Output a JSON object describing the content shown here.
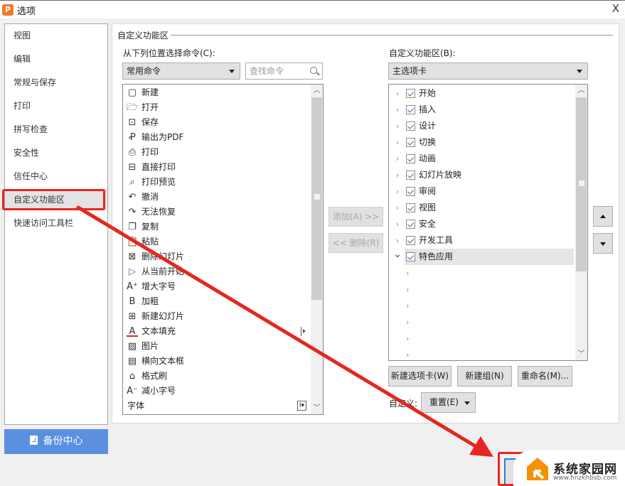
{
  "window": {
    "title": "选项",
    "app_icon": "P",
    "close_label": "X"
  },
  "sidebar": {
    "items": [
      {
        "label": "视图"
      },
      {
        "label": "编辑"
      },
      {
        "label": "常规与保存"
      },
      {
        "label": "打印"
      },
      {
        "label": "拼写检查"
      },
      {
        "label": "安全性"
      },
      {
        "label": "信任中心"
      },
      {
        "label": "自定义功能区",
        "active": true
      },
      {
        "label": "快速访问工具栏"
      }
    ],
    "backup_label": "备份中心"
  },
  "main": {
    "section_title": "自定义功能区",
    "left": {
      "label": "从下列位置选择命令(C):",
      "dropdown_value": "常用命令",
      "search_placeholder": "查找命令",
      "commands": [
        {
          "icon": "new-doc-icon",
          "glyph": "▢",
          "label": "新建"
        },
        {
          "icon": "open-folder-icon",
          "glyph": "🗁",
          "label": "打开"
        },
        {
          "icon": "save-icon",
          "glyph": "⊡",
          "label": "保存"
        },
        {
          "icon": "export-pdf-icon",
          "glyph": "Ꝓ",
          "label": "输出为PDF"
        },
        {
          "icon": "print-icon",
          "glyph": "⎙",
          "label": "打印"
        },
        {
          "icon": "direct-print-icon",
          "glyph": "⊟",
          "label": "直接打印"
        },
        {
          "icon": "print-preview-icon",
          "glyph": "⌕",
          "label": "打印预览"
        },
        {
          "icon": "undo-icon",
          "glyph": "↶",
          "label": "撤消"
        },
        {
          "icon": "redo-icon",
          "glyph": "↷",
          "label": "无法恢复"
        },
        {
          "icon": "copy-icon",
          "glyph": "❐",
          "label": "复制"
        },
        {
          "icon": "paste-icon",
          "glyph": "📋",
          "label": "粘贴"
        },
        {
          "icon": "delete-slide-icon",
          "glyph": "⊠",
          "label": "删除幻灯片"
        },
        {
          "icon": "play-from-current-icon",
          "glyph": "▷",
          "label": "从当前开始"
        },
        {
          "icon": "increase-font-icon",
          "glyph": "A⁺",
          "label": "增大字号"
        },
        {
          "icon": "bold-icon",
          "glyph": "B",
          "label": "加粗"
        },
        {
          "icon": "new-slide-icon",
          "glyph": "⊞",
          "label": "新建幻灯片"
        },
        {
          "icon": "text-fill-icon",
          "glyph": "A",
          "label": "文本填充",
          "submenu": true
        },
        {
          "icon": "picture-icon",
          "glyph": "▨",
          "label": "图片"
        },
        {
          "icon": "textbox-icon",
          "glyph": "▤",
          "label": "横向文本框"
        },
        {
          "icon": "format-painter-icon",
          "glyph": "⌂",
          "label": "格式刷"
        },
        {
          "icon": "decrease-font-icon",
          "glyph": "A⁻",
          "label": "减小字号"
        },
        {
          "icon": "",
          "glyph": "",
          "label": "字体",
          "font_control": "I▾"
        }
      ]
    },
    "add_button": "添加(A) >>",
    "remove_button": "<< 删除(R)",
    "right": {
      "label": "自定义功能区(B):",
      "dropdown_value": "主选项卡",
      "tabs": [
        {
          "label": "开始",
          "checked": true,
          "expanded": false
        },
        {
          "label": "插入",
          "checked": true,
          "expanded": false
        },
        {
          "label": "设计",
          "checked": true,
          "expanded": false
        },
        {
          "label": "切换",
          "checked": true,
          "expanded": false
        },
        {
          "label": "动画",
          "checked": true,
          "expanded": false
        },
        {
          "label": "幻灯片放映",
          "checked": true,
          "expanded": false
        },
        {
          "label": "审阅",
          "checked": true,
          "expanded": false
        },
        {
          "label": "视图",
          "checked": true,
          "expanded": false
        },
        {
          "label": "安全",
          "checked": true,
          "expanded": false
        },
        {
          "label": "开发工具",
          "checked": true,
          "expanded": false
        },
        {
          "label": "特色应用",
          "checked": true,
          "expanded": true,
          "selected": true
        }
      ],
      "child_groups_count": 6,
      "new_tab_button": "新建选项卡(W)",
      "new_group_button": "新建组(N)",
      "rename_button": "重命名(M)...",
      "customize_label": "自定义:",
      "reset_button": "重置(E)"
    }
  },
  "watermark": {
    "text": "系统家园网",
    "url": "www.hnzkhbsb.com"
  },
  "colors": {
    "annotation_red": "#e8251f",
    "backup_blue": "#5b8fe0",
    "app_orange": "#f07a2a",
    "watermark_orange": "#f39200"
  }
}
